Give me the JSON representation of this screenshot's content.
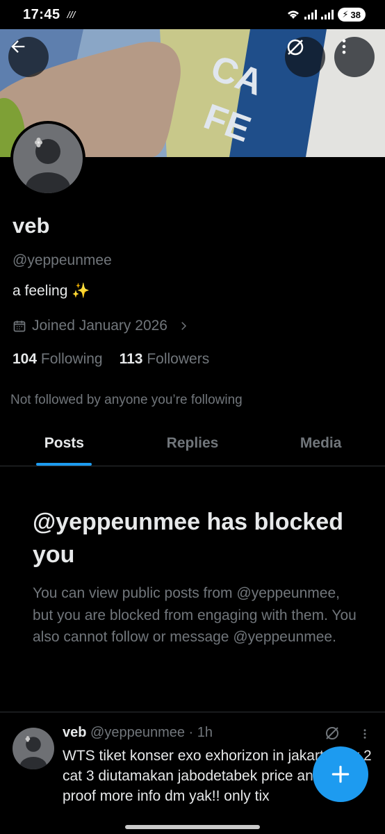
{
  "status_bar": {
    "time": "17:45",
    "battery": "38"
  },
  "profile": {
    "name": "veb",
    "handle": "@yeppeunmee",
    "bio": "a feeling ✨",
    "joined": "Joined January 2026",
    "following_count": "104",
    "following_label": "Following",
    "followers_count": "113",
    "followers_label": "Followers",
    "not_followed_note": "Not followed by anyone you’re following"
  },
  "tabs": [
    {
      "label": "Posts",
      "active": true
    },
    {
      "label": "Replies",
      "active": false
    },
    {
      "label": "Media",
      "active": false
    }
  ],
  "blocked": {
    "title": "@yeppeunmee has blocked you",
    "message": "You can view public posts from @yeppeunmee, but you are blocked from engaging with them. You also cannot follow or message @yeppeunmee."
  },
  "post": {
    "name": "veb",
    "meta": "@yeppeunmee · 1h",
    "text": "WTS tiket konser exo exhorizon in jakarta day 2 cat 3 diutamakan jabodetabek price and all proof more info dm yak!! only tix"
  },
  "colors": {
    "accent": "#1d9bf0",
    "background": "#000000",
    "muted": "#71767b",
    "text": "#e7e9ea",
    "border": "#2f3336"
  },
  "icons": [
    "back-arrow-icon",
    "grok-icon",
    "more-vertical-icon",
    "calendar-icon",
    "chevron-right-icon",
    "plus-icon",
    "wifi-icon",
    "signal-icon",
    "battery-icon"
  ]
}
